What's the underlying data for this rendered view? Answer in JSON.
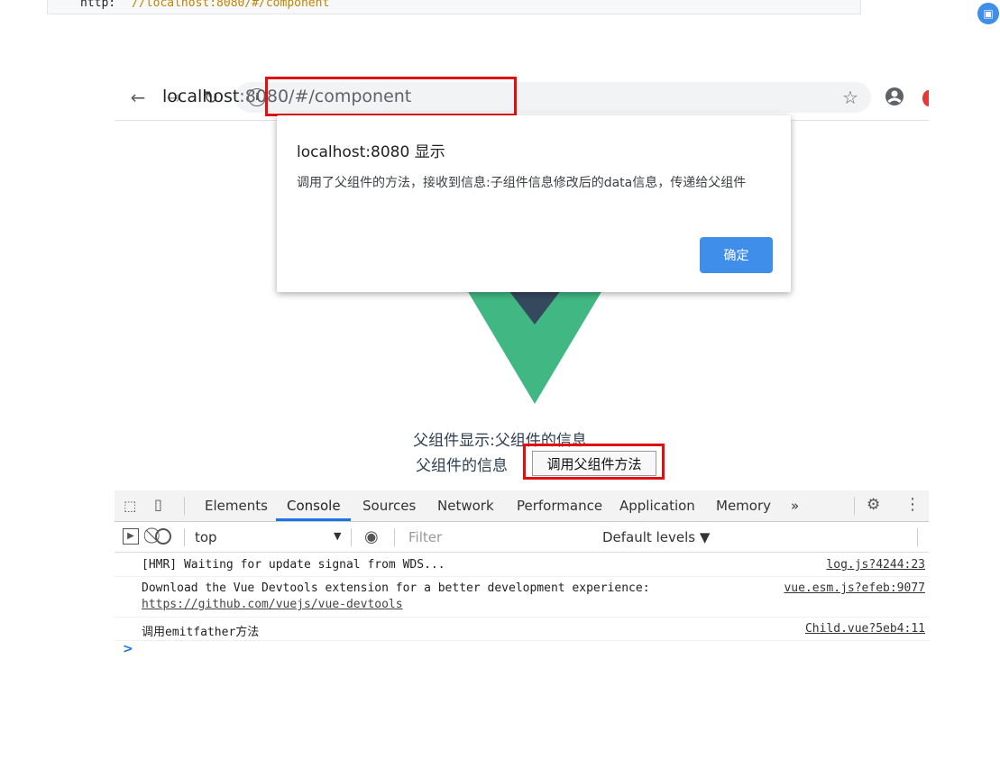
{
  "code_strip": {
    "prefix": "http:",
    "url": "//localhost:8080/#/component"
  },
  "browser": {
    "url_host": "localhost",
    "url_rest": ":8080/#/component",
    "icons": [
      "back-arrow-icon",
      "forward-arrow-icon",
      "reload-icon",
      "info-icon",
      "star-icon",
      "account-icon"
    ]
  },
  "alert": {
    "title": "localhost:8080 显示",
    "message": "调用了父组件的方法，接收到信息:子组件信息修改后的data信息，传递给父组件",
    "ok_label": "确定"
  },
  "page": {
    "parent_display": "父组件显示:父组件的信息",
    "parent_info": "父组件的信息",
    "call_button": "调用父组件方法"
  },
  "devtools": {
    "tabs": [
      "Elements",
      "Console",
      "Sources",
      "Network",
      "Performance",
      "Application",
      "Memory",
      "»"
    ],
    "active_tab": "Console",
    "context": "top",
    "filter_placeholder": "Filter",
    "levels": "Default levels ▼",
    "logs": [
      {
        "text": "[HMR] Waiting for update signal from WDS...",
        "source": "log.js?4244:23"
      },
      {
        "text": "Download the Vue Devtools extension for a better development experience:",
        "link": "https://github.com/vuejs/vue-devtools",
        "source": "vue.esm.js?efeb:9077"
      },
      {
        "text": "调用emitfather方法",
        "source": "Child.vue?5eb4:11"
      }
    ],
    "prompt": ">"
  },
  "colors": {
    "vue_green": "#41b883",
    "vue_dark": "#35495e",
    "highlight_red": "#e01010",
    "accent_blue": "#3f8ee9"
  }
}
